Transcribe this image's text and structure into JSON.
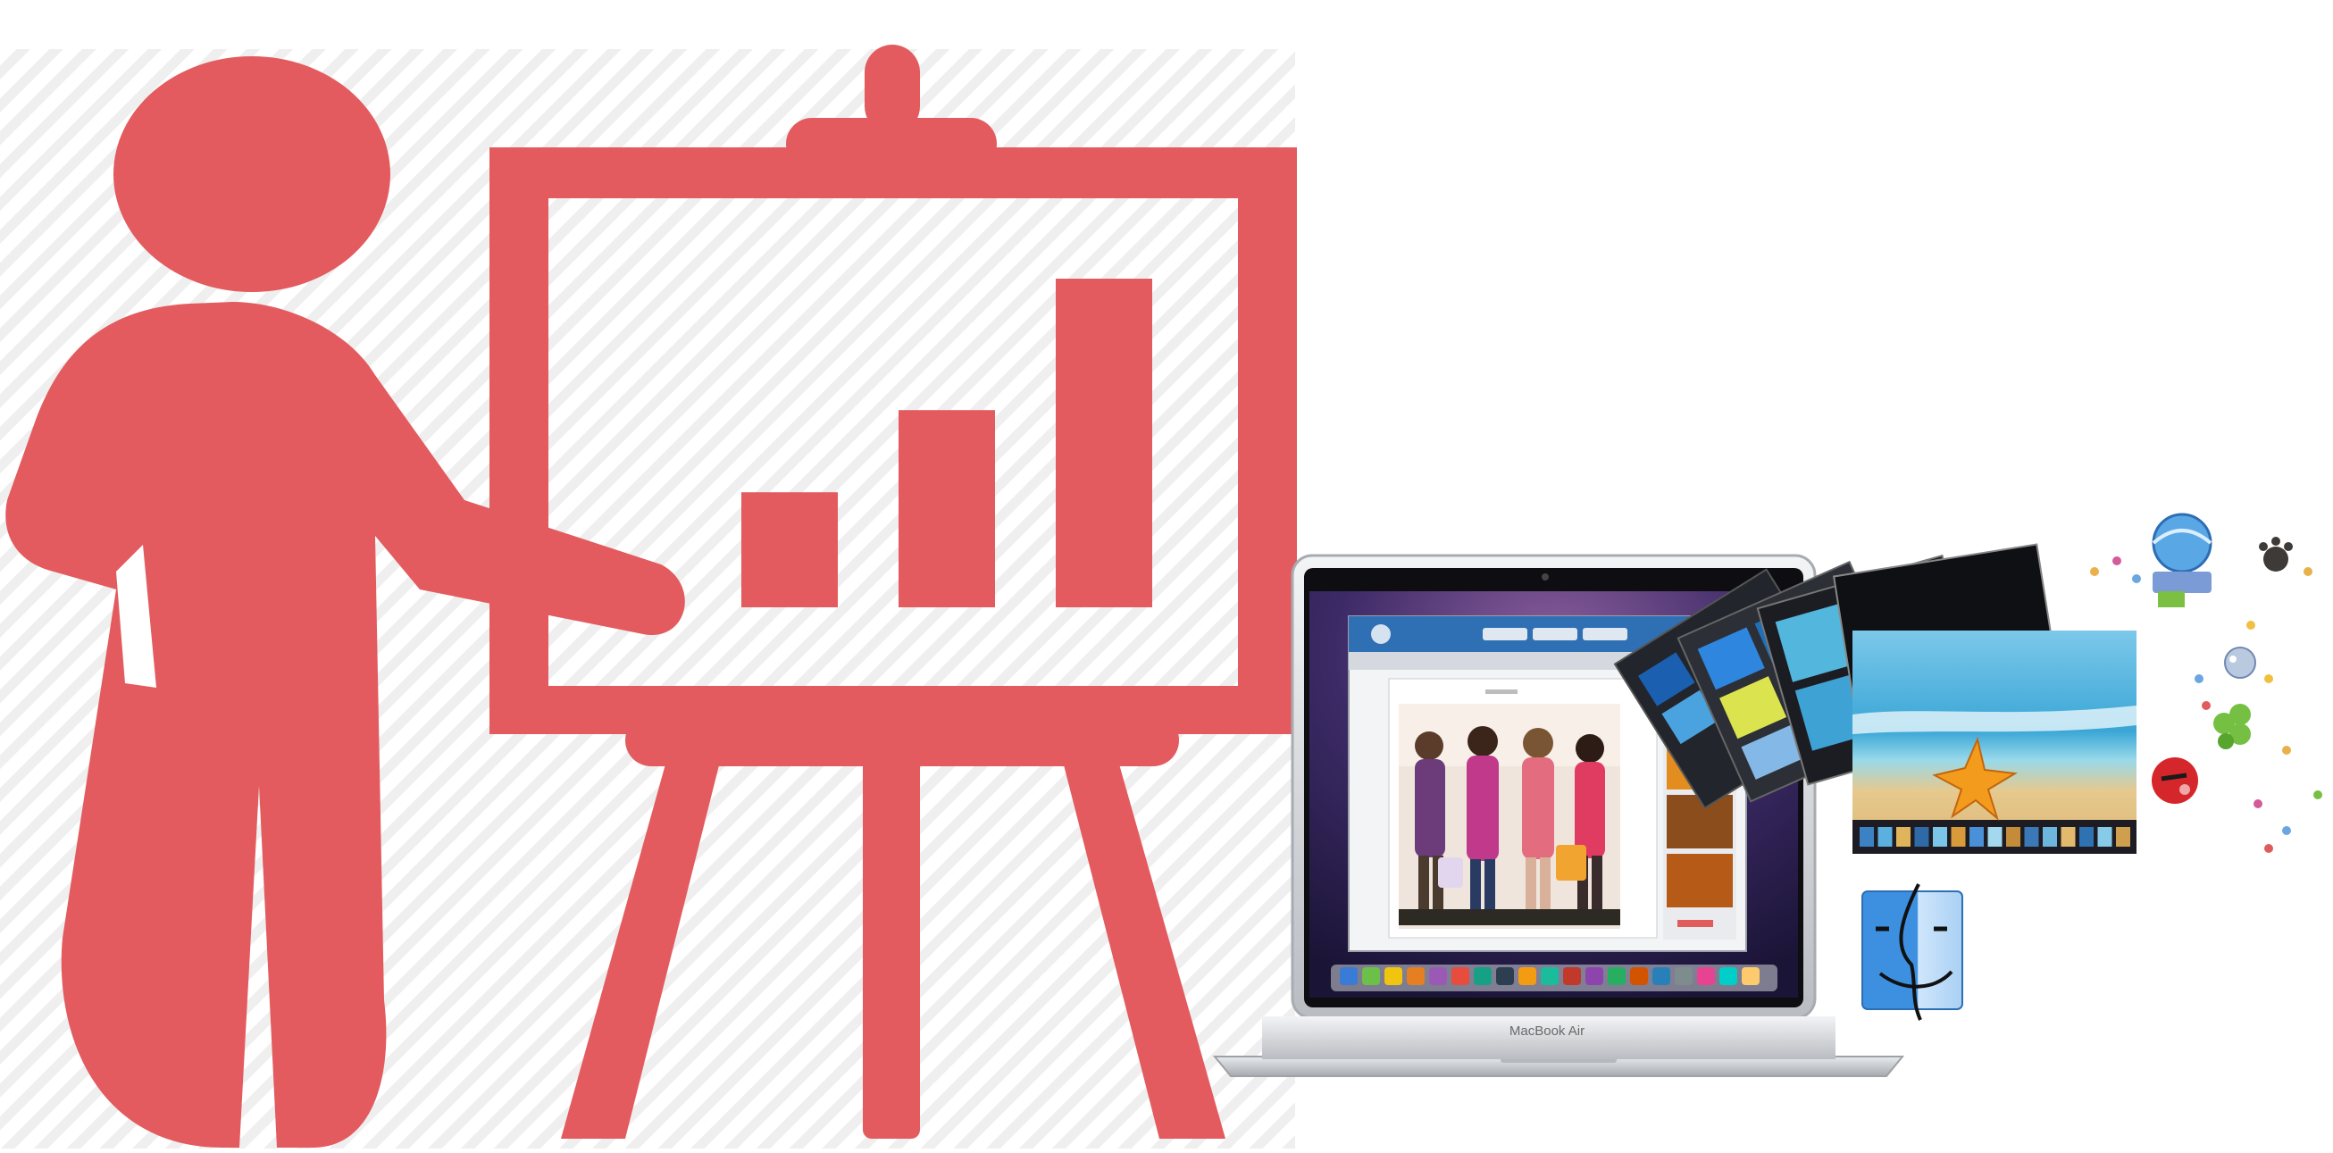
{
  "scene": {
    "palette": {
      "presenter_red": "#e35b5e",
      "hatch_gray": "#eeeeee",
      "background": "#ffffff",
      "laptop_silver": "#d7d9dc",
      "screen_purple": "#3c2a66",
      "sky_blue": "#53b6dd",
      "sand": "#e7c98d",
      "starfish_orange": "#f29b1d"
    },
    "presenter": {
      "icon": "presentation-person-icon",
      "chart_icon": "bar-chart-icon",
      "chart_bars": [
        {
          "name": "low",
          "level": 0.35
        },
        {
          "name": "mid",
          "level": 0.6
        },
        {
          "name": "high",
          "level": 1.0
        }
      ]
    },
    "laptop": {
      "icon": "laptop-icon",
      "brand_label": "MacBook Air"
    },
    "floating_items": {
      "photo_stack_icon": "photo-stack-icon",
      "beach_photo_icon": "beach-photo-icon",
      "finder_icon": "finder-icon",
      "decorative_icons": [
        "globe-icon",
        "paw-icon",
        "bubble-icon",
        "ladybug-icon",
        "clover-icon"
      ]
    }
  }
}
